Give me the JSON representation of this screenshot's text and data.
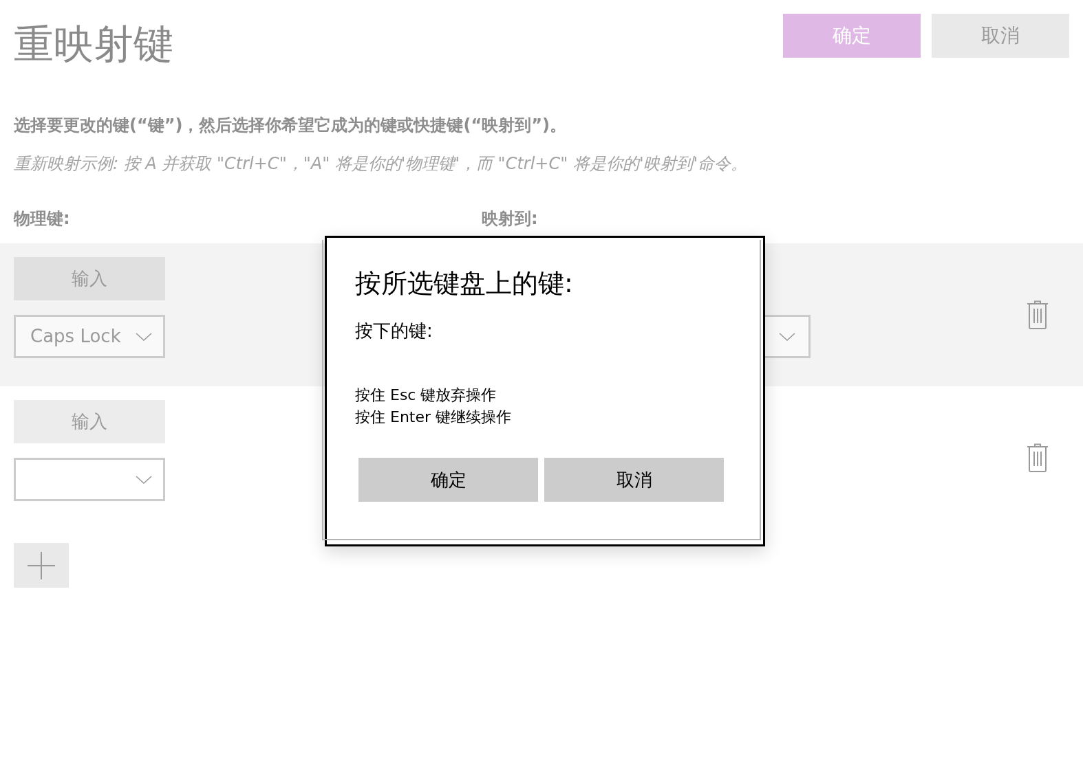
{
  "header": {
    "title": "重映射键",
    "buttons": [
      {
        "label": "确定",
        "kind": "primary"
      },
      {
        "label": "取消",
        "kind": "secondary"
      }
    ]
  },
  "instructions": {
    "text": "选择要更改的键(“键”)，然后选择你希望它成为的键或快捷键(“映射到”)。",
    "example": "重新映射示例: 按 A 并获取 \"Ctrl+C\"，\"A\" 将是你的'物理键'，而 \"Ctrl+C\" 将是你的'映射到'命令。"
  },
  "columns": [
    "物理键:",
    "映射到:"
  ],
  "rows": [
    {
      "selected": true,
      "input_button": "输入",
      "key": "Caps Lock",
      "mapped_dropdown": true
    },
    {
      "selected": false,
      "input_button": "输入",
      "mapped_dropdown": false
    }
  ],
  "dialog": {
    "title": "按所选键盘上的键:",
    "pressed_label": "按下的键:",
    "hints": [
      "按住 Esc 键放弃操作",
      "按住 Enter 键继续操作"
    ],
    "buttons": [
      "确定",
      "取消"
    ]
  }
}
